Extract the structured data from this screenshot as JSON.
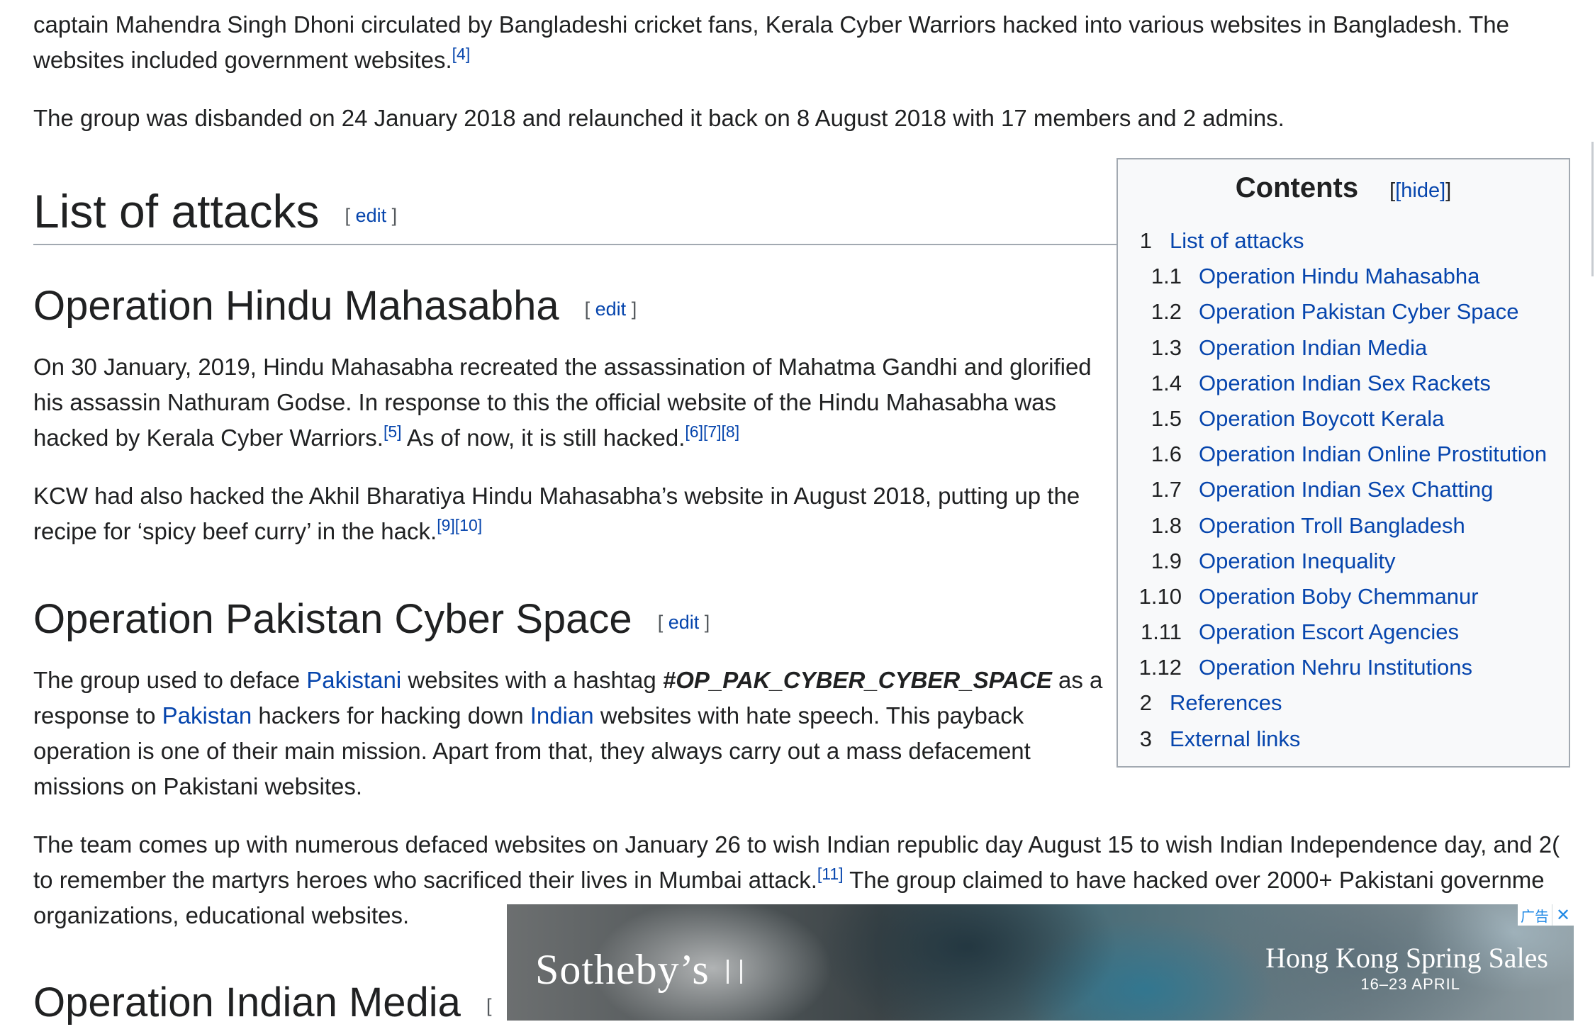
{
  "article": {
    "intro_p1": "captain Mahendra Singh Dhoni circulated by Bangladeshi cricket fans, Kerala Cyber Warriors hacked into various websites in Bangladesh. The",
    "intro_p1_line2": "websites included government websites.",
    "intro_p1_ref": "[4]",
    "intro_p2": "The group was disbanded on 24 January 2018 and relaunched it back on 8 August 2018 with 17 members and 2 admins.",
    "edit_open": "[",
    "edit_label": "edit",
    "edit_close": "]",
    "sections": {
      "list_of_attacks": {
        "title": "List of attacks"
      },
      "hindu_mahasabha": {
        "title": "Operation Hindu Mahasabha",
        "p1_l1": "On 30 January, 2019, Hindu Mahasabha recreated the assassination of Mahatma Gandhi and glorified",
        "p1_l2": "his assassin Nathuram Godse. In response to this the official website of the Hindu Mahasabha was",
        "p1_l3a": "hacked by Kerala Cyber Warriors.",
        "p1_ref1": "[5]",
        "p1_l3b": " As of now, it is still hacked.",
        "p1_ref2": "[6][7][8]",
        "p2_l1": "KCW had also hacked the Akhil Bharatiya Hindu Mahasabha’s website in August 2018, putting up the",
        "p2_l2": "recipe for ‘spicy beef curry’ in the hack.",
        "p2_ref": "[9][10]"
      },
      "pakistan_cyber_space": {
        "title": "Operation Pakistan Cyber Space",
        "p1_a": "The group used to deface ",
        "p1_link1": "Pakistani",
        "p1_b": " websites with a hashtag ",
        "p1_hashtag": "#OP_PAK_CYBER_CYBER_SPACE",
        "p1_c": " as a",
        "p1_l2a": "response to ",
        "p1_link2": "Pakistan",
        "p1_l2b": " hackers for hacking down ",
        "p1_link3": "Indian",
        "p1_l2c": " websites with hate speech. This payback",
        "p1_l3": "operation is one of their main mission. Apart from that, they always carry out a mass defacement",
        "p1_l4": "missions on Pakistani websites.",
        "p2_l1": "The team comes up with numerous defaced websites on January 26 to wish Indian republic day August 15 to wish Indian Independence day, and 2(",
        "p2_l2a": "to remember the martyrs heroes who sacrificed their lives in Mumbai attack.",
        "p2_ref": "[11]",
        "p2_l2b": " The group claimed to have hacked over 2000+ Pakistani governme",
        "p2_l3": "organizations, educational websites."
      },
      "indian_media": {
        "title": "Operation Indian Media",
        "edit_partial": "["
      }
    }
  },
  "toc": {
    "title": "Contents",
    "toggle": "[hide]",
    "items": [
      {
        "num": "1",
        "label": "List of attacks",
        "level": 1
      },
      {
        "num": "1.1",
        "label": "Operation Hindu Mahasabha",
        "level": 2
      },
      {
        "num": "1.2",
        "label": "Operation Pakistan Cyber Space",
        "level": 2
      },
      {
        "num": "1.3",
        "label": "Operation Indian Media",
        "level": 2
      },
      {
        "num": "1.4",
        "label": "Operation Indian Sex Rackets",
        "level": 2
      },
      {
        "num": "1.5",
        "label": "Operation Boycott Kerala",
        "level": 2
      },
      {
        "num": "1.6",
        "label": "Operation Indian Online Prostitution",
        "level": 2
      },
      {
        "num": "1.7",
        "label": "Operation Indian Sex Chatting",
        "level": 2
      },
      {
        "num": "1.8",
        "label": "Operation Troll Bangladesh",
        "level": 2
      },
      {
        "num": "1.9",
        "label": "Operation Inequality",
        "level": 2
      },
      {
        "num": "1.10",
        "label": "Operation Boby Chemmanur",
        "level": 2
      },
      {
        "num": "1.11",
        "label": "Operation Escort Agencies",
        "level": 2
      },
      {
        "num": "1.12",
        "label": "Operation Nehru Institutions",
        "level": 2
      },
      {
        "num": "2",
        "label": "References",
        "level": 1
      },
      {
        "num": "3",
        "label": "External links",
        "level": 1
      }
    ]
  },
  "ad": {
    "brand": "Sotheby’s",
    "headline": "Hong Kong Spring Sales",
    "dates": "16–23 APRIL",
    "label": "广告",
    "close_icon": "close-icon"
  },
  "colors": {
    "link": "#0645ad",
    "text": "#202122",
    "toc_bg": "#f8f9fa",
    "border": "#a2a9b1"
  }
}
